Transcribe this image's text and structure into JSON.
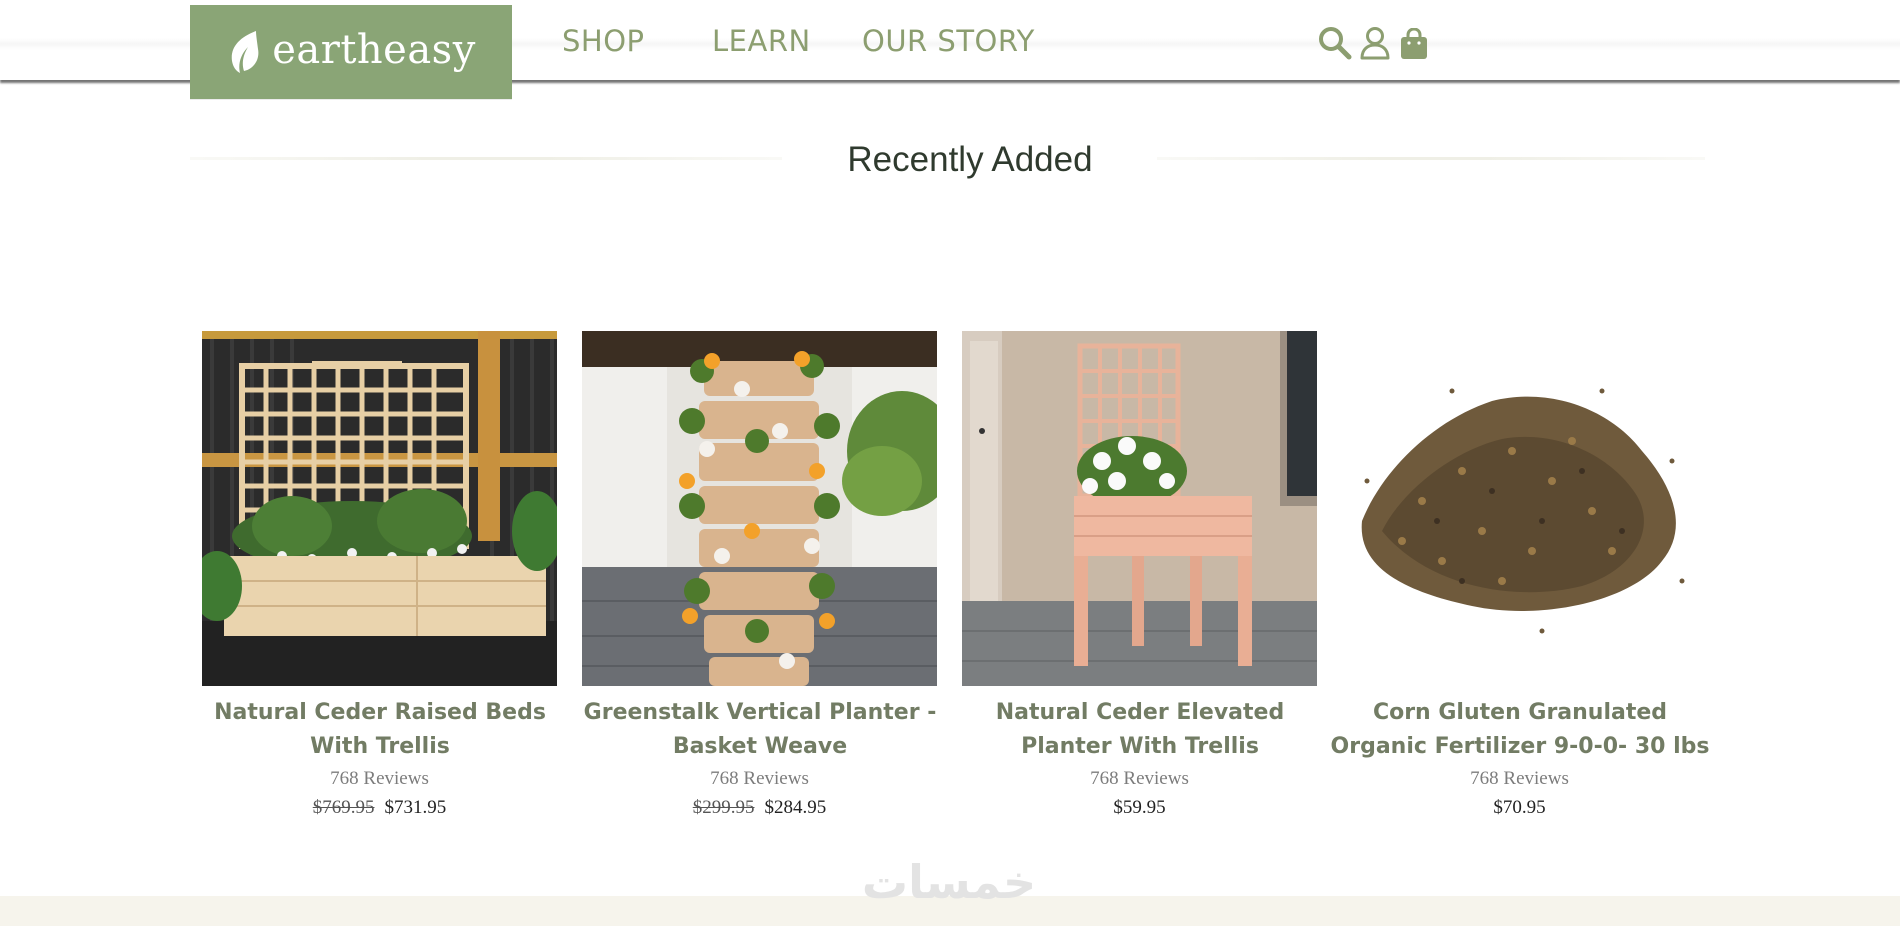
{
  "header": {
    "brand": "eartheasy",
    "nav": [
      {
        "label": "SHOP"
      },
      {
        "label": "LEARN"
      },
      {
        "label": "OUR STORY"
      }
    ],
    "icons": [
      "search-icon",
      "account-icon",
      "shopping-bag-icon"
    ]
  },
  "section": {
    "title": "Recently Added"
  },
  "products": [
    {
      "name": "Natural Ceder Raised Beds With Trellis",
      "reviews": "768 Reviews",
      "old_price": "$769.95",
      "price": "$731.95"
    },
    {
      "name": "Greenstalk Vertical Planter - Basket Weave",
      "reviews": "768 Reviews",
      "old_price": "$299.95",
      "price": "$284.95"
    },
    {
      "name": "Natural Ceder Elevated Planter With Trellis",
      "reviews": "768 Reviews",
      "old_price": "",
      "price": "$59.95"
    },
    {
      "name": "Corn Gluten Granulated Organic Fertilizer 9-0-0- 30 lbs",
      "reviews": "768 Reviews",
      "old_price": "",
      "price": "$70.95"
    }
  ],
  "watermark": "خمسات",
  "colors": {
    "brand_green": "#8aa576",
    "nav_text": "#8c9e70",
    "product_name": "#727c64"
  }
}
